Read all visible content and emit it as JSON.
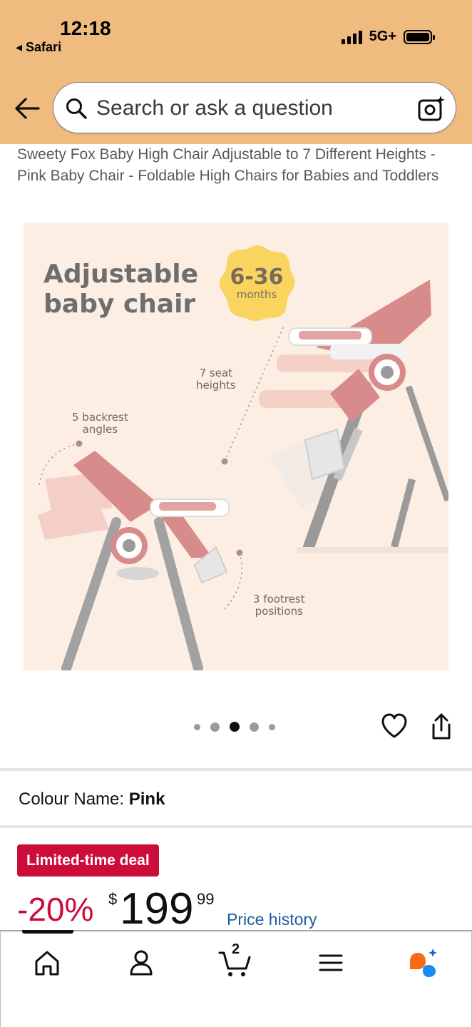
{
  "status_bar": {
    "time": "12:18",
    "back_app": "◂ Safari",
    "network": "5G+"
  },
  "search": {
    "placeholder": "Search or ask a question"
  },
  "product": {
    "title": "Sweety Fox Baby High Chair Adjustable to 7 Different Heights - Pink Baby Chair - Foldable High Chairs for Babies and Toddlers",
    "image": {
      "heading_line1": "Adjustable",
      "heading_line2": "baby chair",
      "age_range": "6-36",
      "age_unit": "months",
      "annotation_seat": [
        "7 seat",
        "heights"
      ],
      "annotation_backrest": [
        "5 backrest",
        "angles"
      ],
      "annotation_footrest": [
        "3 footrest",
        "positions"
      ]
    },
    "carousel": {
      "count": 5,
      "active_index": 2
    },
    "colour_label": "Colour Name:",
    "colour_value": "Pink",
    "deal_badge": "Limited-time deal",
    "discount": "-20%",
    "currency": "$",
    "price_whole": "199",
    "price_fraction": "99",
    "price_history_link": "Price history"
  },
  "bottom_nav": {
    "active": "home",
    "cart_count": "2"
  },
  "colors": {
    "header": "#efbb7e",
    "deal": "#cc0c39",
    "link": "#1f5b9e",
    "chair_pink": "#d88b8b"
  }
}
